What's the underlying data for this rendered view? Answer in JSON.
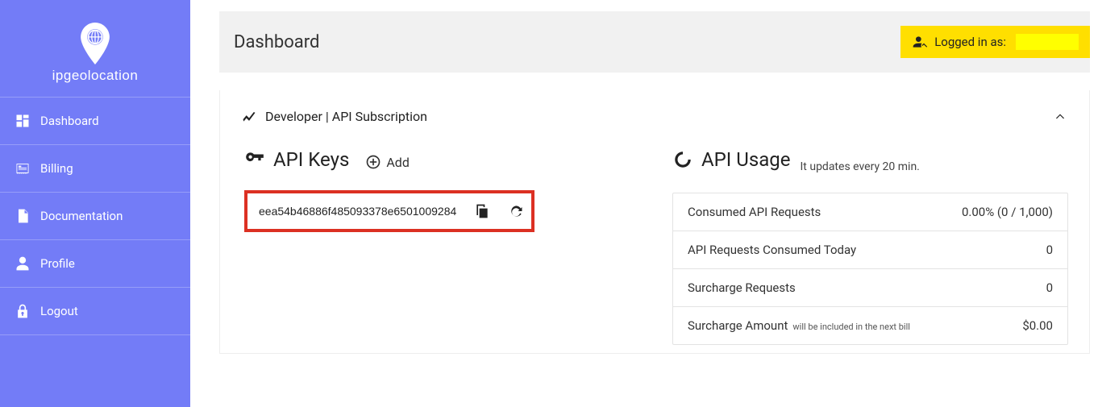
{
  "brand": {
    "name": "ipgeolocation"
  },
  "sidebar": {
    "items": [
      {
        "label": "Dashboard"
      },
      {
        "label": "Billing"
      },
      {
        "label": "Documentation"
      },
      {
        "label": "Profile"
      },
      {
        "label": "Logout"
      }
    ]
  },
  "header": {
    "title": "Dashboard",
    "logged_in_prefix": "Logged in as:"
  },
  "panel": {
    "title": "Developer | API Subscription"
  },
  "api_keys": {
    "title": "API Keys",
    "add_label": "Add",
    "keys": [
      {
        "value": "eea54b46886f485093378e6501009284"
      }
    ]
  },
  "api_usage": {
    "title": "API Usage",
    "subtitle": "It updates every 20 min.",
    "rows": [
      {
        "label": "Consumed API Requests",
        "value": "0.00% (0 / 1,000)",
        "note": ""
      },
      {
        "label": "API Requests Consumed Today",
        "value": "0",
        "note": ""
      },
      {
        "label": "Surcharge Requests",
        "value": "0",
        "note": ""
      },
      {
        "label": "Surcharge Amount",
        "value": "$0.00",
        "note": "will be included in the next bill"
      }
    ]
  }
}
